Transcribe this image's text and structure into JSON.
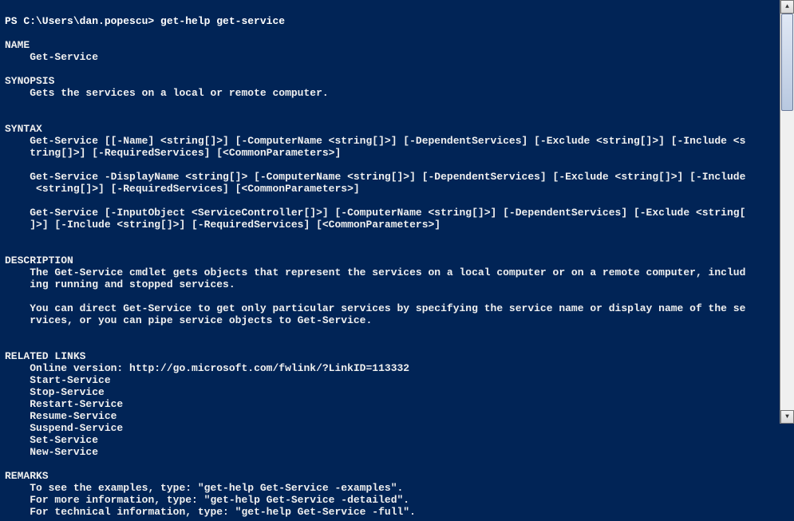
{
  "prompt": "PS C:\\Users\\dan.popescu> get-help get-service",
  "sections": {
    "name_hdr": "NAME",
    "name_val": "    Get-Service",
    "synopsis_hdr": "SYNOPSIS",
    "synopsis_val": "    Gets the services on a local or remote computer.",
    "syntax_hdr": "SYNTAX",
    "syntax_1": "    Get-Service [[-Name] <string[]>] [-ComputerName <string[]>] [-DependentServices] [-Exclude <string[]>] [-Include <s\n    tring[]>] [-RequiredServices] [<CommonParameters>]",
    "syntax_2": "    Get-Service -DisplayName <string[]> [-ComputerName <string[]>] [-DependentServices] [-Exclude <string[]>] [-Include\n     <string[]>] [-RequiredServices] [<CommonParameters>]",
    "syntax_3": "    Get-Service [-InputObject <ServiceController[]>] [-ComputerName <string[]>] [-DependentServices] [-Exclude <string[\n    ]>] [-Include <string[]>] [-RequiredServices] [<CommonParameters>]",
    "desc_hdr": "DESCRIPTION",
    "desc_1": "    The Get-Service cmdlet gets objects that represent the services on a local computer or on a remote computer, includ\n    ing running and stopped services.",
    "desc_2": "    You can direct Get-Service to get only particular services by specifying the service name or display name of the se\n    rvices, or you can pipe service objects to Get-Service.",
    "links_hdr": "RELATED LINKS",
    "links_1": "    Online version: http://go.microsoft.com/fwlink/?LinkID=113332 ",
    "links_2": "    Start-Service ",
    "links_3": "    Stop-Service ",
    "links_4": "    Restart-Service ",
    "links_5": "    Resume-Service ",
    "links_6": "    Suspend-Service ",
    "links_7": "    Set-Service ",
    "links_8": "    New-Service ",
    "remarks_hdr": "REMARKS",
    "remarks_1": "    To see the examples, type: \"get-help Get-Service -examples\".",
    "remarks_2": "    For more information, type: \"get-help Get-Service -detailed\".",
    "remarks_3": "    For technical information, type: \"get-help Get-Service -full\"."
  },
  "icons": {
    "up": "▲",
    "down": "▼"
  }
}
